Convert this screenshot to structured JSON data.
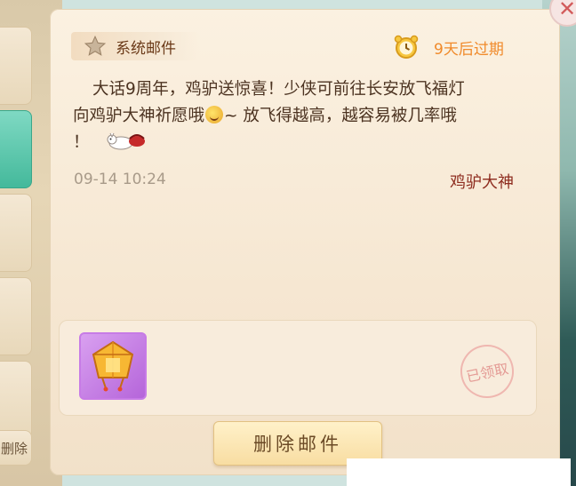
{
  "mail": {
    "category": "系统邮件",
    "expire_text": "9天后过期",
    "body_line1": "大话9周年，鸡驴送惊喜！少侠可前往长安放飞福灯",
    "body_line2a": "向鸡驴大神祈愿哦",
    "body_line2b": "~ 放飞得越高，越容易被几率哦",
    "body_line3": "！",
    "time": "09-14 10:24",
    "sender": "鸡驴大神"
  },
  "attachment": {
    "item_name": "福灯",
    "status_stamp": "已领取"
  },
  "actions": {
    "delete_label": "删除邮件",
    "side_delete_label": "删除"
  },
  "icons": {
    "close": "close-icon",
    "star": "star-icon",
    "clock": "alarm-clock-icon",
    "emoji": "grin-emoji-icon",
    "donkey": "donkey-sticker-icon",
    "lantern": "sky-lantern-icon"
  },
  "colors": {
    "sender": "#8e2c1f",
    "expire": "#f08a2a",
    "active_tab": "#44b99b",
    "item_slot": "#b565da"
  }
}
